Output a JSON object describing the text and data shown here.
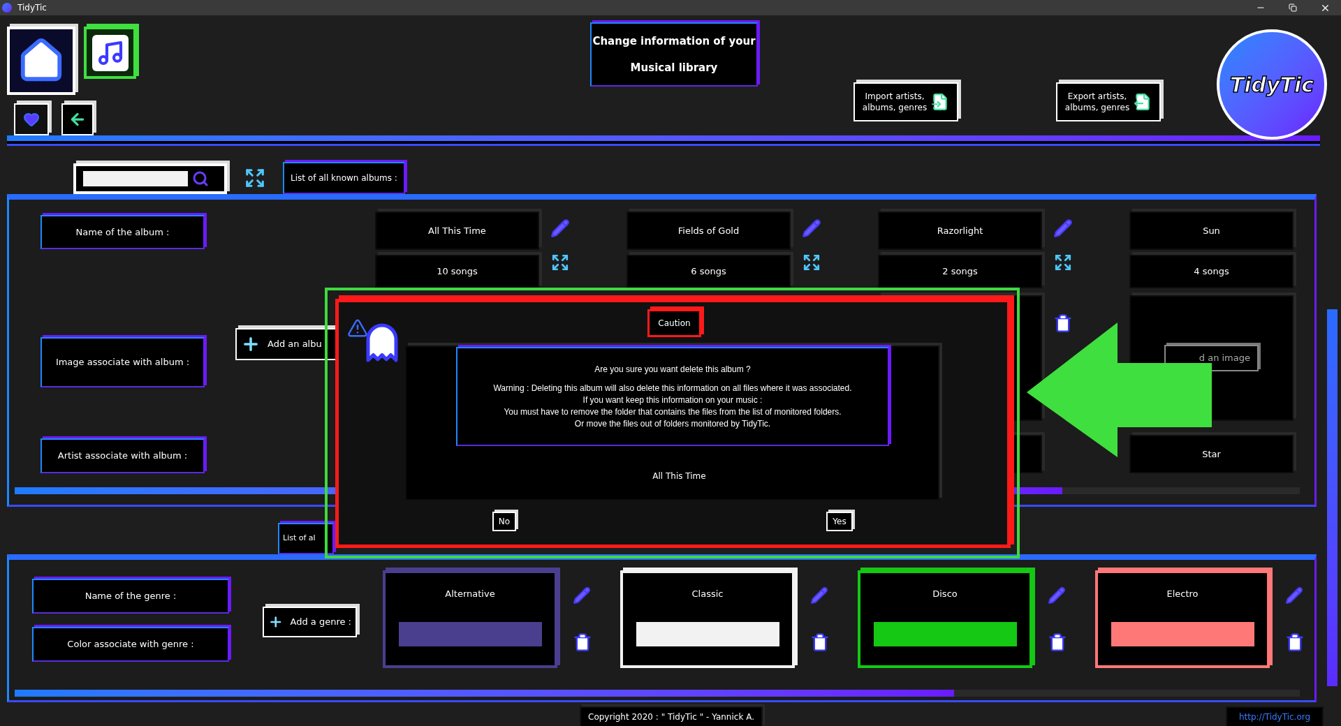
{
  "window": {
    "title": "TidyTic"
  },
  "header": {
    "title_lines": [
      "Change information of your",
      "Musical library"
    ],
    "import_button": [
      "Import artists,",
      "albums, genres"
    ],
    "export_button": [
      "Export artists,",
      "albums, genres"
    ],
    "logo_text": "TidyTic"
  },
  "albums": {
    "tab": "List of all known albums :",
    "labels": [
      "Name of the album :",
      "Image associate with album :",
      "Artist associate with album :"
    ],
    "add_button": "Add an albu",
    "columns": [
      {
        "kind": "covered",
        "name": "All This Time",
        "songs": "10 songs"
      },
      {
        "kind": "covered",
        "name": "Fields of Gold",
        "songs": "6 songs"
      },
      {
        "kind": "edge",
        "name": "Razorlight",
        "songs": "2 songs"
      },
      {
        "kind": "open",
        "name": "Sun",
        "songs": "4 songs",
        "image_button": "d an image",
        "artist": "Star"
      }
    ]
  },
  "dialog": {
    "tab": "Caution",
    "message_lines": [
      "Are you sure you want delete this album ?",
      "Warning : Deleting this album will also delete this information on all files where it was associated.",
      "If you want keep this information on your music :",
      "You must have to remove the folder that contains the files from the list of monitored folders.",
      "Or move the files out of folders monitored by TidyTic."
    ],
    "album": "All This Time",
    "buttons": [
      "No",
      "Yes"
    ]
  },
  "genres": {
    "tab": "List of al",
    "labels": [
      "Name of the genre :",
      "Color associate with genre :"
    ],
    "add_button": "Add a genre :",
    "items": [
      {
        "name": "Alternative",
        "color": "#4a3f8f"
      },
      {
        "name": "Classic",
        "color": "#f2f2f2"
      },
      {
        "name": "Disco",
        "color": "#14c814"
      },
      {
        "name": "Electro",
        "color": "#ff7878"
      }
    ]
  },
  "footer": {
    "copyright": "Copyright 2020 : \" TidyTic \" - Yannick A.",
    "link": "http://TidyTic.org"
  }
}
